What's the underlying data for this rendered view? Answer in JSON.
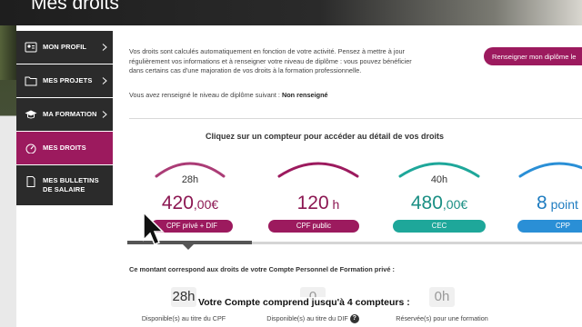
{
  "header": {
    "title": "Mes droits"
  },
  "sidebar": {
    "items": [
      {
        "label": "MON PROFIL",
        "icon": "id-card-icon",
        "chevron": true
      },
      {
        "label": "MES PROJETS",
        "icon": "folder-icon",
        "chevron": true
      },
      {
        "label": "MA FORMATION",
        "icon": "graduation-cap-icon",
        "chevron": true
      },
      {
        "label": "MES DROITS",
        "icon": "gauge-icon",
        "chevron": false
      },
      {
        "label": "MES BULLETINS DE SALAIRE",
        "icon": "document-icon",
        "chevron": false
      }
    ],
    "active_index": 3
  },
  "main": {
    "intro": "Vos droits sont calculés automatiquement en fonction de votre activité. Pensez à mettre à jour régulièrement vos informations et à renseigner votre niveau de diplôme : vous pouvez bénéficier dans certains cas d'une majoration de vos droits à la formation professionnelle.",
    "level_prefix": "Vous avez renseigné le niveau de diplôme suivant : ",
    "level_value": "Non renseigné",
    "diploma_button": "Renseigner mon diplôme le",
    "counters_title": "Cliquez sur un compteur pour accéder au détail de vos droits",
    "counters": [
      {
        "hours": "28h",
        "amount": "420",
        "amount_suffix": ",00€",
        "label": "CPF privé + DIF",
        "color": "#9c1a5e",
        "amount_color": "#8c1752"
      },
      {
        "hours": "",
        "amount": "120",
        "amount_suffix": " h",
        "label": "CPF public",
        "color": "#9c1a5e",
        "amount_color": "#8c1752"
      },
      {
        "hours": "40h",
        "amount": "480",
        "amount_suffix": ",00€",
        "label": "CEC",
        "color": "#1ea79a",
        "amount_color": "#1a8f84"
      },
      {
        "hours": "",
        "amount": "8",
        "amount_suffix": " point",
        "label": "CPP",
        "color": "#2a8fd6",
        "amount_color": "#1e7cc0"
      }
    ],
    "section_text": "Ce montant correspond aux droits de votre Compte Personnel de Formation privé :",
    "mini": [
      {
        "value": "28h",
        "caption": "Disponible(s) au titre du CPF",
        "info": false
      },
      {
        "value": "0",
        "caption": "Disponible(s) au titre du DIF",
        "info": true
      },
      {
        "value": "0h",
        "caption": "Réservée(s) pour une formation",
        "info": false
      }
    ],
    "overlay_caption": "Votre Compte comprend jusqu'à 4 compteurs :"
  }
}
